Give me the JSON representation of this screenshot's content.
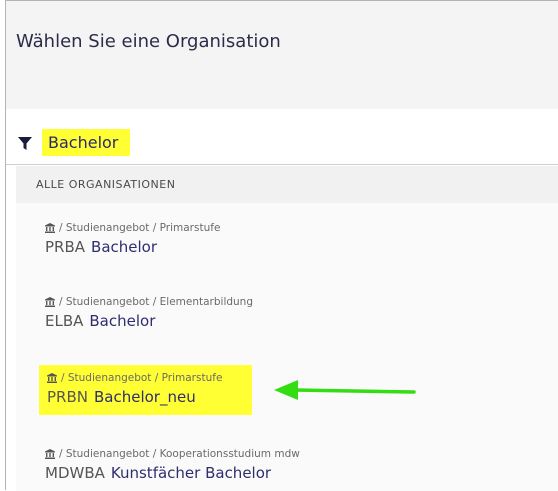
{
  "dialog": {
    "title": "Wählen Sie eine Organisation"
  },
  "filter": {
    "icon": "filter-icon",
    "value": "Bachelor"
  },
  "section": {
    "title": "ALLE ORGANISATIONEN"
  },
  "organizations": [
    {
      "path": "/ Studienangebot / Primarstufe",
      "code": "PRBA",
      "name": "Bachelor",
      "highlighted": false
    },
    {
      "path": "/ Studienangebot / Elementarbildung",
      "code": "ELBA",
      "name": "Bachelor",
      "highlighted": false
    },
    {
      "path": "/ Studienangebot / Primarstufe",
      "code": "PRBN",
      "name": "Bachelor_neu",
      "highlighted": true
    },
    {
      "path": "/ Studienangebot / Kooperationsstudium mdw",
      "code": "MDWBA",
      "name": "Kunstfächer Bachelor",
      "highlighted": false
    }
  ],
  "colors": {
    "highlight": "#ffff33",
    "arrow": "#33dd11",
    "link_text": "#2e2e6e"
  }
}
